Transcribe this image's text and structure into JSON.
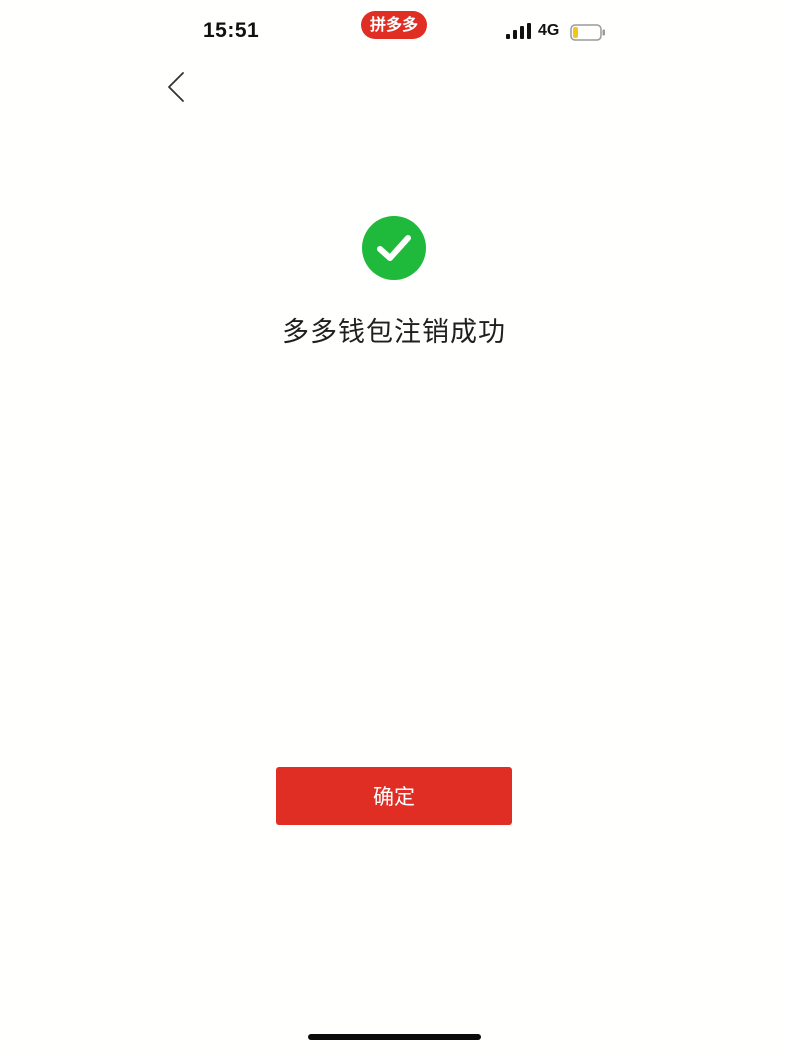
{
  "status_bar": {
    "time": "15:51",
    "app_badge": "拼多多",
    "network": "4G",
    "battery_level": 0.2,
    "colors": {
      "app_badge_bg": "#e02e24",
      "battery_fill": "#f5c518"
    }
  },
  "nav": {
    "back_icon": "chevron-left-icon"
  },
  "result": {
    "icon": "check-circle-icon",
    "icon_color": "#1fb93b",
    "title": "多多钱包注销成功"
  },
  "actions": {
    "confirm_label": "确定",
    "confirm_color": "#e02e24"
  }
}
